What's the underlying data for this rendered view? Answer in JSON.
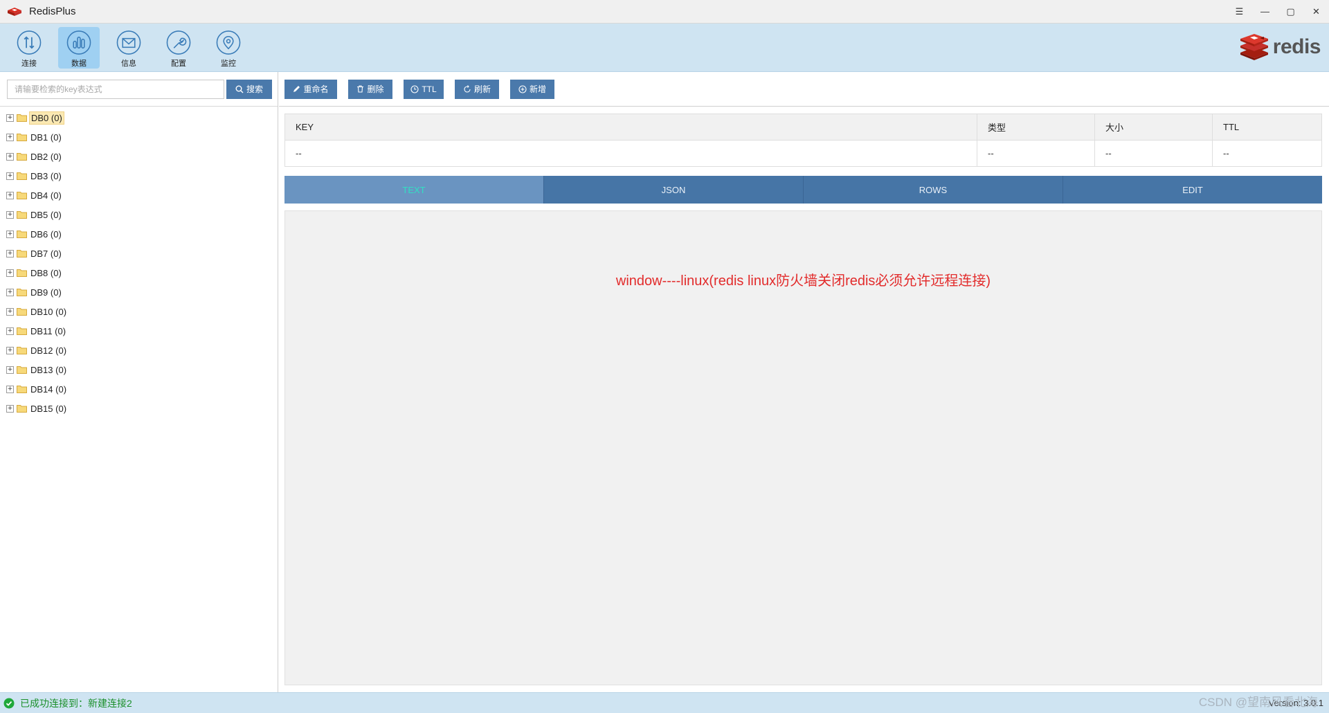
{
  "app": {
    "title": "RedisPlus"
  },
  "window_controls": {
    "menu": "☰",
    "minimize": "—",
    "maximize": "▢",
    "close": "✕"
  },
  "ribbon": {
    "items": [
      {
        "label": "连接",
        "icon": "connect-icon"
      },
      {
        "label": "数据",
        "icon": "data-icon",
        "active": true
      },
      {
        "label": "信息",
        "icon": "mail-icon"
      },
      {
        "label": "配置",
        "icon": "wrench-icon"
      },
      {
        "label": "监控",
        "icon": "monitor-icon"
      }
    ],
    "brand": "redis"
  },
  "search": {
    "placeholder": "请输要检索的key表达式",
    "button_label": "搜索"
  },
  "tree": {
    "items": [
      "DB0 (0)",
      "DB1 (0)",
      "DB2 (0)",
      "DB3 (0)",
      "DB4 (0)",
      "DB5 (0)",
      "DB6 (0)",
      "DB7 (0)",
      "DB8 (0)",
      "DB9 (0)",
      "DB10 (0)",
      "DB11 (0)",
      "DB12 (0)",
      "DB13 (0)",
      "DB14 (0)",
      "DB15 (0)"
    ],
    "selected": "DB0 (0)",
    "expander": "+"
  },
  "toolbar": {
    "rename": "重命名",
    "delete": "删除",
    "ttl": "TTL",
    "refresh": "刷新",
    "add": "新增"
  },
  "key_table": {
    "headers": [
      "KEY",
      "类型",
      "大小",
      "TTL"
    ],
    "row": [
      "--",
      "--",
      "--",
      "--"
    ]
  },
  "tabs": {
    "items": [
      "TEXT",
      "JSON",
      "ROWS",
      "EDIT"
    ],
    "active": "TEXT"
  },
  "note": "window----linux(redis linux防火墙关闭redis必须允许远程连接)",
  "status": {
    "text": "已成功连接到：新建连接2",
    "version": "Version: 3.0.1"
  },
  "watermark": "CSDN @望南风看北海",
  "colors": {
    "accent": "#4a79ab",
    "ribbon_bg": "#cfe4f2",
    "note_red": "#e22b2b",
    "status_green": "#1b8f2b",
    "active_tab_text": "#31e0c2"
  }
}
